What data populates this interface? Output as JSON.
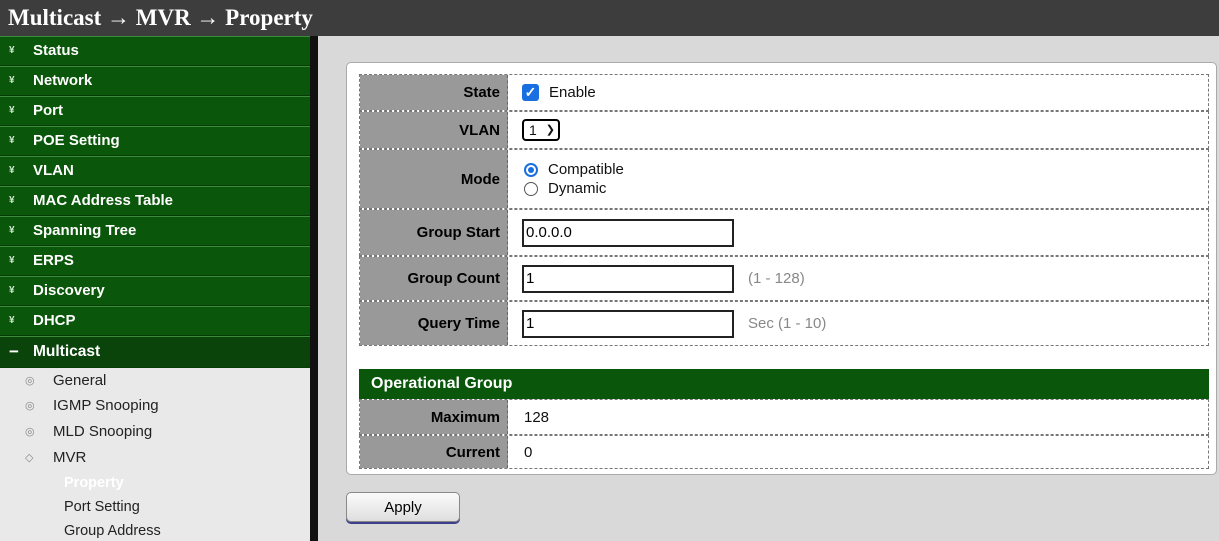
{
  "header": {
    "title": "Multicast → MVR → Property"
  },
  "sidebar": {
    "sections": [
      {
        "label": "Status"
      },
      {
        "label": "Network"
      },
      {
        "label": "Port"
      },
      {
        "label": "POE Setting"
      },
      {
        "label": "VLAN"
      },
      {
        "label": "MAC Address Table"
      },
      {
        "label": "Spanning Tree"
      },
      {
        "label": "ERPS"
      },
      {
        "label": "Discovery"
      },
      {
        "label": "DHCP"
      },
      {
        "label": "Multicast"
      }
    ],
    "expanded_marker": "−",
    "collapsed_marker": "¥",
    "multicast_items": [
      {
        "label": "General"
      },
      {
        "label": "IGMP Snooping"
      },
      {
        "label": "MLD Snooping"
      },
      {
        "label": "MVR"
      }
    ],
    "mvr_items": [
      {
        "label": "Property"
      },
      {
        "label": "Port Setting"
      },
      {
        "label": "Group Address"
      }
    ]
  },
  "form": {
    "state": {
      "label": "State",
      "option": "Enable",
      "checked": true
    },
    "vlan": {
      "label": "VLAN",
      "selected": "1"
    },
    "mode": {
      "label": "Mode",
      "options": [
        "Compatible",
        "Dynamic"
      ],
      "selected": "Compatible"
    },
    "group_start": {
      "label": "Group Start",
      "value": "0.0.0.0"
    },
    "group_count": {
      "label": "Group Count",
      "value": "1",
      "hint": "(1 - 128)"
    },
    "query_time": {
      "label": "Query Time",
      "value": "1",
      "hint": "Sec (1 - 10)"
    }
  },
  "operational": {
    "header": "Operational Group",
    "maximum": {
      "label": "Maximum",
      "value": "128"
    },
    "current": {
      "label": "Current",
      "value": "0"
    }
  },
  "buttons": {
    "apply": "Apply"
  },
  "colors": {
    "nav_green": "#0a560a",
    "top_bar": "#3d3d3d",
    "accent_blue": "#1a6fe0",
    "label_gray": "#999999"
  }
}
